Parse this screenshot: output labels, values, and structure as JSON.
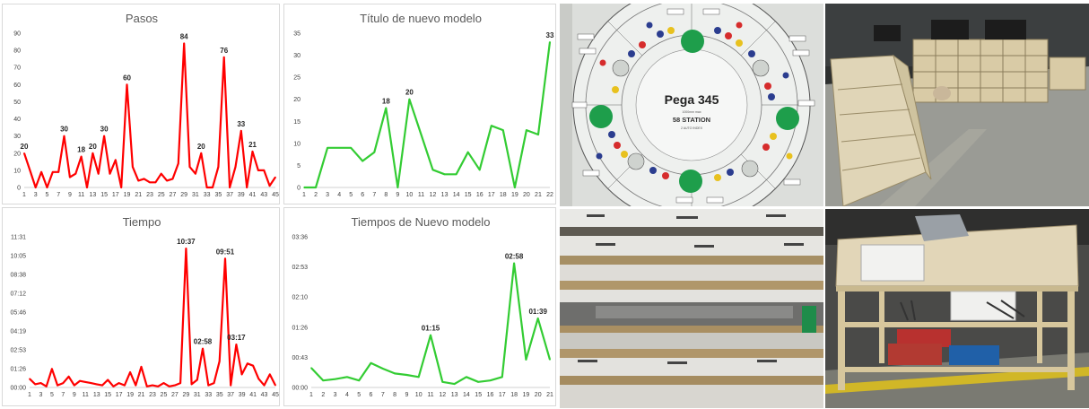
{
  "chart_data": [
    {
      "type": "line",
      "title": "Pasos",
      "color": "#ff0000",
      "ylim": [
        0,
        90
      ],
      "yticks": [
        "0",
        "10",
        "20",
        "30",
        "40",
        "50",
        "60",
        "70",
        "80",
        "90"
      ],
      "x": [
        1,
        2,
        3,
        4,
        5,
        6,
        7,
        8,
        9,
        10,
        11,
        12,
        13,
        14,
        15,
        16,
        17,
        18,
        19,
        20,
        21,
        22,
        23,
        24,
        25,
        26,
        27,
        28,
        29,
        30,
        31,
        32,
        33,
        34,
        35,
        36,
        37,
        38,
        39,
        40,
        41,
        42,
        43,
        44,
        45
      ],
      "xticks": [
        "1",
        "3",
        "5",
        "7",
        "9",
        "11",
        "13",
        "15",
        "17",
        "19",
        "21",
        "23",
        "25",
        "27",
        "29",
        "31",
        "33",
        "35",
        "37",
        "39",
        "41",
        "43",
        "45"
      ],
      "values": [
        20,
        10,
        0,
        9,
        0,
        9,
        9,
        30,
        6,
        8,
        18,
        0,
        20,
        8,
        30,
        8,
        16,
        0,
        60,
        12,
        4,
        5,
        3,
        3,
        8,
        4,
        5,
        14,
        84,
        12,
        8,
        20,
        0,
        0,
        12,
        76,
        0,
        12,
        33,
        0,
        21,
        10,
        10,
        1,
        6
      ],
      "labels": [
        {
          "x": 1,
          "text": "20"
        },
        {
          "x": 8,
          "text": "30"
        },
        {
          "x": 11,
          "text": "18"
        },
        {
          "x": 13,
          "text": "20"
        },
        {
          "x": 15,
          "text": "30"
        },
        {
          "x": 19,
          "text": "60"
        },
        {
          "x": 29,
          "text": "84"
        },
        {
          "x": 32,
          "text": "20"
        },
        {
          "x": 36,
          "text": "76"
        },
        {
          "x": 39,
          "text": "33"
        },
        {
          "x": 41,
          "text": "21"
        }
      ]
    },
    {
      "type": "line",
      "title": "Título de nuevo modelo",
      "color": "#33cc33",
      "ylim": [
        0,
        35
      ],
      "yticks": [
        "0",
        "5",
        "10",
        "15",
        "20",
        "25",
        "30",
        "35"
      ],
      "x": [
        1,
        2,
        3,
        4,
        5,
        6,
        7,
        8,
        9,
        10,
        11,
        12,
        13,
        14,
        15,
        16,
        17,
        18,
        19,
        20,
        21,
        22
      ],
      "xticks": [
        "1",
        "2",
        "3",
        "4",
        "5",
        "6",
        "7",
        "8",
        "9",
        "10",
        "11",
        "12",
        "13",
        "14",
        "15",
        "16",
        "17",
        "18",
        "19",
        "20",
        "21",
        "22"
      ],
      "values": [
        0,
        0,
        9,
        9,
        9,
        6,
        8,
        18,
        0,
        20,
        12,
        4,
        3,
        3,
        8,
        4,
        14,
        13,
        0,
        13,
        12,
        33
      ],
      "labels": [
        {
          "x": 8,
          "text": "18"
        },
        {
          "x": 10,
          "text": "20"
        },
        {
          "x": 22,
          "text": "33"
        }
      ]
    },
    {
      "type": "line",
      "title": "Tiempo",
      "color": "#ff0000",
      "ylim": [
        0,
        691
      ],
      "yunit": "seconds",
      "yticks": [
        "00:00",
        "01:26",
        "02:53",
        "04:19",
        "05:46",
        "07:12",
        "08:38",
        "10:05",
        "11:31"
      ],
      "x": [
        1,
        2,
        3,
        4,
        5,
        6,
        7,
        8,
        9,
        10,
        11,
        12,
        13,
        14,
        15,
        16,
        17,
        18,
        19,
        20,
        21,
        22,
        23,
        24,
        25,
        26,
        27,
        28,
        29,
        30,
        31,
        32,
        33,
        34,
        35,
        36,
        37,
        38,
        39,
        40,
        41,
        42,
        43,
        44,
        45
      ],
      "xticks": [
        "1",
        "3",
        "5",
        "7",
        "9",
        "11",
        "13",
        "15",
        "17",
        "19",
        "21",
        "23",
        "25",
        "27",
        "29",
        "31",
        "33",
        "35",
        "37",
        "39",
        "41",
        "43",
        "45"
      ],
      "values": [
        40,
        15,
        20,
        5,
        85,
        10,
        20,
        50,
        10,
        30,
        25,
        20,
        15,
        10,
        35,
        5,
        20,
        10,
        70,
        10,
        95,
        5,
        10,
        5,
        20,
        5,
        10,
        20,
        637,
        15,
        35,
        178,
        10,
        20,
        120,
        591,
        10,
        197,
        60,
        110,
        100,
        40,
        10,
        60,
        10
      ],
      "labels": [
        {
          "x": 29,
          "text": "10:37"
        },
        {
          "x": 32,
          "text": "02:58"
        },
        {
          "x": 36,
          "text": "09:51"
        },
        {
          "x": 38,
          "text": "03:17"
        }
      ]
    },
    {
      "type": "line",
      "title": "Tiempos de Nuevo modelo",
      "color": "#33cc33",
      "ylim": [
        0,
        216
      ],
      "yunit": "seconds",
      "yticks": [
        "00:00",
        "00:43",
        "01:26",
        "02:10",
        "02:53",
        "03:36"
      ],
      "x": [
        1,
        2,
        3,
        4,
        5,
        6,
        7,
        8,
        9,
        10,
        11,
        12,
        13,
        14,
        15,
        16,
        17,
        18,
        19,
        20,
        21
      ],
      "xticks": [
        "1",
        "2",
        "3",
        "4",
        "5",
        "6",
        "7",
        "8",
        "9",
        "10",
        "11",
        "12",
        "13",
        "14",
        "15",
        "16",
        "17",
        "18",
        "19",
        "20",
        "21"
      ],
      "values": [
        28,
        10,
        12,
        15,
        10,
        35,
        27,
        20,
        18,
        15,
        75,
        8,
        5,
        15,
        8,
        10,
        15,
        178,
        40,
        99,
        40
      ],
      "labels": [
        {
          "x": 11,
          "text": "01:15"
        },
        {
          "x": 18,
          "text": "02:58"
        },
        {
          "x": 20,
          "text": "01:39"
        }
      ]
    }
  ],
  "photos": {
    "sign": {
      "title": "Pega 345",
      "subtitle": "58 STATION",
      "subtitle2": "2 AUTO INDEX",
      "small": "1000mm max"
    }
  }
}
